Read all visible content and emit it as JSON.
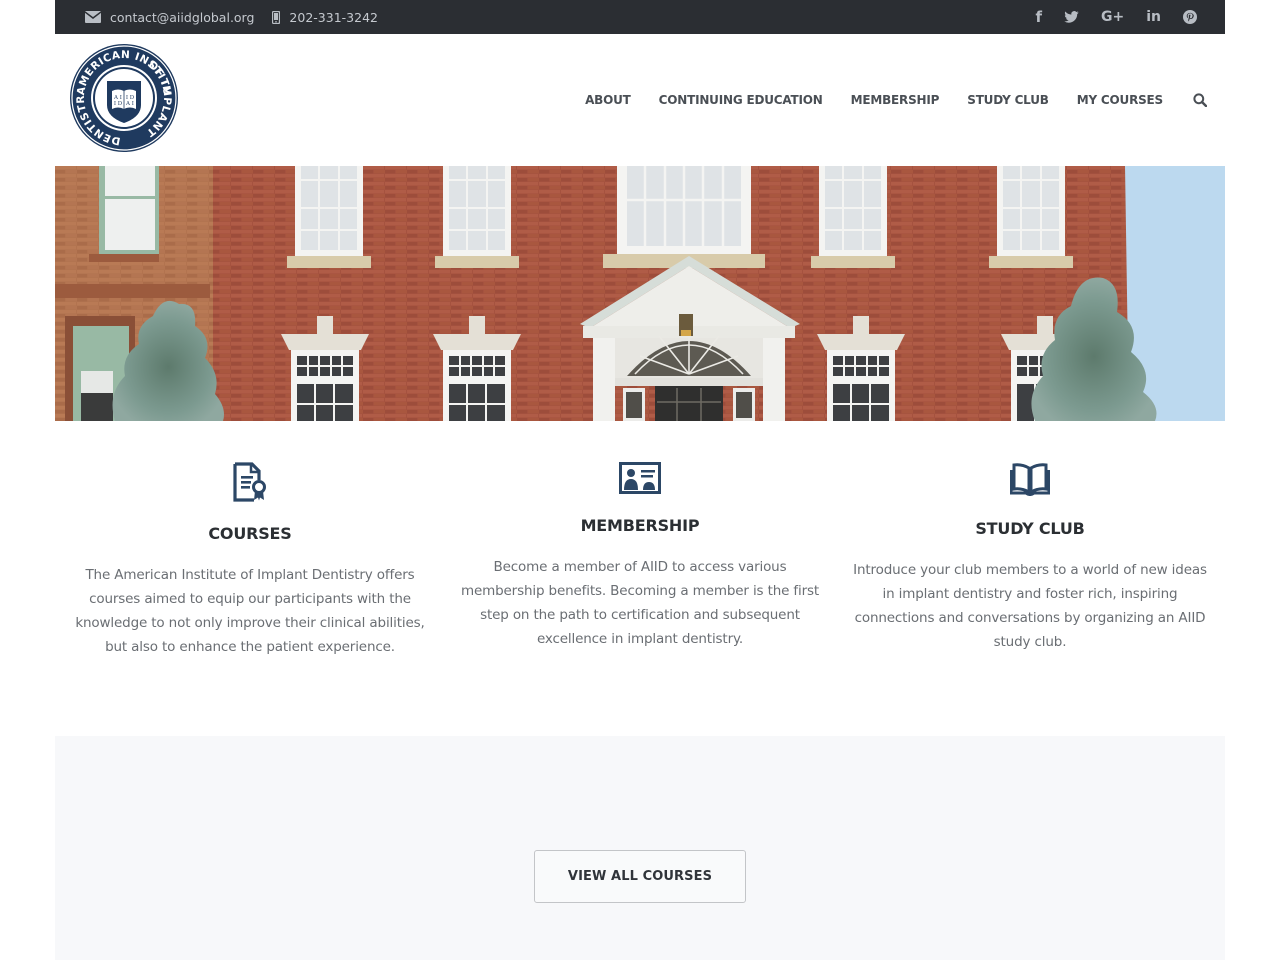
{
  "topbar": {
    "email": "contact@aiidglobal.org",
    "phone": "202-331-3242",
    "email_icon": "envelope-icon",
    "phone_icon": "mobile-phone-icon",
    "social": [
      {
        "name": "facebook",
        "icon": "facebook-icon",
        "glyph": "f"
      },
      {
        "name": "twitter",
        "icon": "twitter-icon",
        "glyph": ""
      },
      {
        "name": "google-plus",
        "icon": "google-plus-icon",
        "glyph": "G+"
      },
      {
        "name": "linkedin",
        "icon": "linkedin-icon",
        "glyph": "in"
      },
      {
        "name": "pinterest",
        "icon": "pinterest-icon",
        "glyph": ""
      }
    ]
  },
  "header": {
    "logo_text_top": "AMERICAN INSTITUTE",
    "logo_text_right": "OF IMPLANT",
    "logo_text_left": "DENTISTRY",
    "logo_book_glyphs": [
      "A",
      "I",
      "I",
      "D"
    ],
    "nav": [
      {
        "label": "ABOUT"
      },
      {
        "label": "CONTINUING EDUCATION"
      },
      {
        "label": "MEMBERSHIP"
      },
      {
        "label": "STUDY CLUB"
      },
      {
        "label": "MY COURSES"
      }
    ],
    "search_icon": "search-icon"
  },
  "hero": {
    "alt": "Brick building facade with white windows, arched portico entrance and evergreen trees"
  },
  "features": [
    {
      "icon": "certificate-document-icon",
      "title": "COURSES",
      "text": "The American Institute of Implant Dentistry offers courses aimed to equip our participants with the knowledge to not  only improve their clinical abilities, but also to enhance the patient experience."
    },
    {
      "icon": "id-card-icon",
      "title": "MEMBERSHIP",
      "text": "Become a member of AIID to access various membership benefits. Becoming a member is the first step on the path to certification and subsequent excellence in implant dentistry."
    },
    {
      "icon": "open-book-icon",
      "title": "STUDY CLUB",
      "text": "Introduce your club members to a world of new ideas in implant dentistry and foster rich, inspiring connections and conversations by organizing an AIID study club."
    }
  ],
  "courses_section": {
    "button_label": "VIEW ALL COURSES"
  },
  "colors": {
    "topbar_bg": "#2b2e33",
    "brand_navy": "#1f3a5f",
    "icon_navy": "#2c4766",
    "heading": "#2b2f33",
    "body_text": "#6a6e73",
    "band_bg": "#f7f8fa"
  }
}
